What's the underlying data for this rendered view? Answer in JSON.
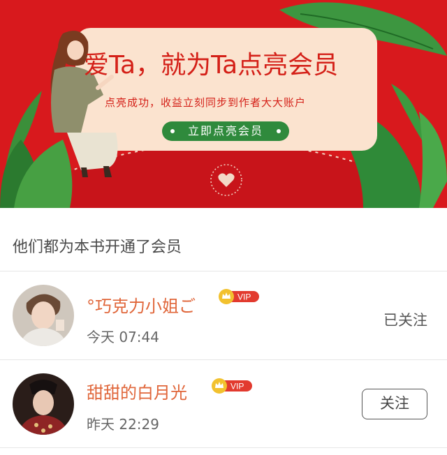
{
  "banner": {
    "headline": "爱Ta，就为Ta点亮会员",
    "subline": "点亮成功，收益立刻同步到作者大大账户",
    "cta_label": "立即点亮会员"
  },
  "section": {
    "title": "他们都为本书开通了会员"
  },
  "members": [
    {
      "name": "°巧克力小姐ご",
      "badge": "VIP",
      "time": "今天 07:44",
      "action": "已关注"
    },
    {
      "name": "甜甜的白月光",
      "badge": "VIP",
      "time": "昨天 22:29",
      "action": "关注"
    }
  ],
  "colors": {
    "banner_red": "#d8191d",
    "card_cream": "#fbe3cf",
    "cta_green": "#2f8a3c",
    "name_orange": "#e0663a",
    "vip_gold": "#f2c12e",
    "vip_red": "#e23a2e"
  }
}
